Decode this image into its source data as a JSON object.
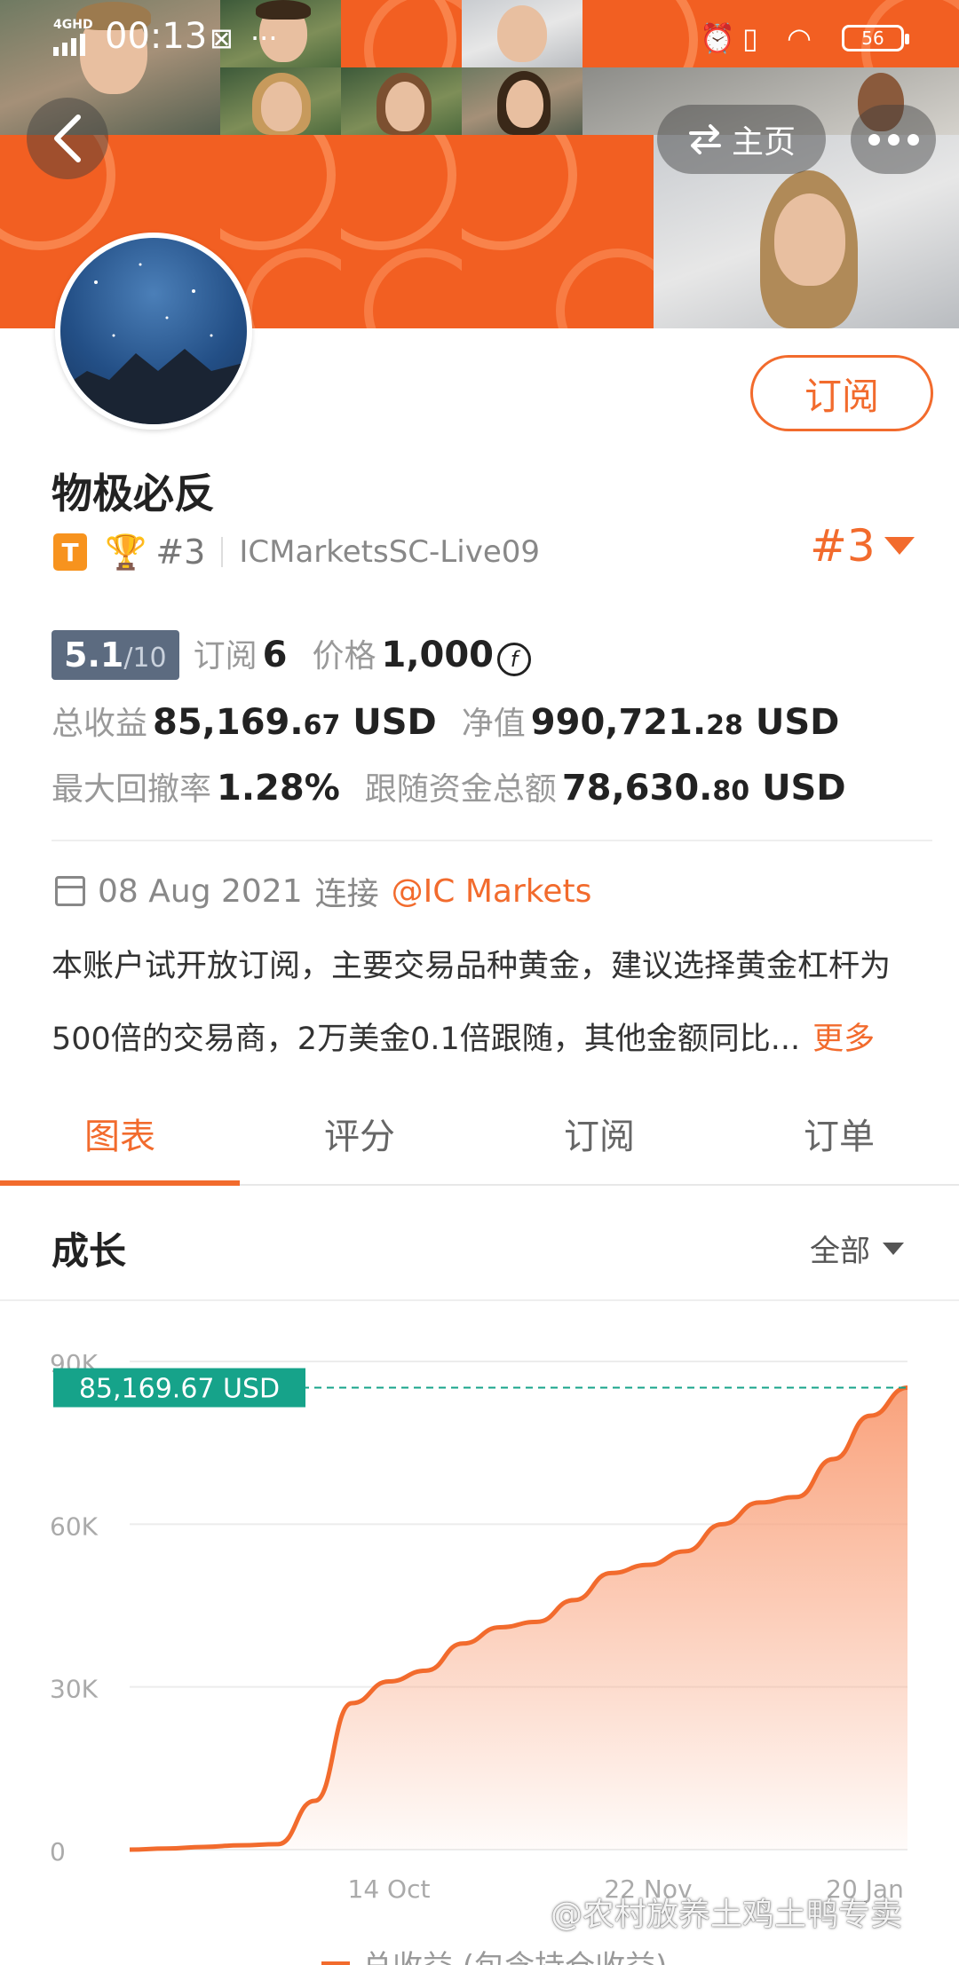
{
  "status_bar": {
    "network": "4GHD",
    "time": "00:13",
    "battery": "56"
  },
  "header": {
    "home_label": "主页",
    "subscribe_label": "订阅"
  },
  "profile": {
    "name": "物极必反",
    "badge_letter": "T",
    "rank_small": "#3",
    "server": "ICMarketsSC-Live09",
    "rank_big": "#3"
  },
  "stats": {
    "score": "5.1",
    "score_max": "/10",
    "subscribers_label": "订阅",
    "subscribers": "6",
    "price_label": "价格",
    "price": "1,000",
    "total_profit_label": "总收益",
    "total_profit_int": "85,169.",
    "total_profit_dec": "67",
    "total_profit_unit": "USD",
    "net_value_label": "净值",
    "net_value_int": "990,721.",
    "net_value_dec": "28",
    "net_value_unit": "USD",
    "max_drawdown_label": "最大回撤率",
    "max_drawdown": "1.28%",
    "follow_funds_label": "跟随资金总额",
    "follow_funds_int": "78,630.",
    "follow_funds_dec": "80",
    "follow_funds_unit": "USD"
  },
  "connection": {
    "date": "08 Aug 2021",
    "connect_word": "连接",
    "broker": "@IC Markets"
  },
  "description": {
    "line1": "本账户试开放订阅，主要交易品种黄金，建议选择黄金杠杆为",
    "line2": "500倍的交易商，2万美金0.1倍跟随，其他金额同比...",
    "more": "更多"
  },
  "tabs": [
    {
      "label": "图表",
      "active": true
    },
    {
      "label": "评分",
      "active": false
    },
    {
      "label": "订阅",
      "active": false
    },
    {
      "label": "订单",
      "active": false
    }
  ],
  "section": {
    "title": "成长",
    "filter": "全部"
  },
  "chart_data": {
    "type": "area",
    "y_ticks": [
      "90K",
      "60K",
      "30K",
      "0"
    ],
    "ylim": [
      0,
      90000
    ],
    "x_ticks": [
      "14 Oct",
      "22 Nov",
      "20 Jan"
    ],
    "last_value_label": "85,169.67 USD",
    "series": [
      {
        "name": "总收益 (包含持仓收益)",
        "values": [
          0,
          200,
          500,
          800,
          1000,
          9000,
          27000,
          31000,
          33000,
          38000,
          41000,
          42000,
          46000,
          51000,
          52500,
          55000,
          60000,
          64000,
          65000,
          72000,
          80000,
          85169.67
        ]
      }
    ],
    "colors": {
      "line": "#f26b2d",
      "fill_top": "#f9a27c",
      "marker": "#16a38a"
    }
  },
  "watermark": "@农村放养土鸡土鸭专卖"
}
